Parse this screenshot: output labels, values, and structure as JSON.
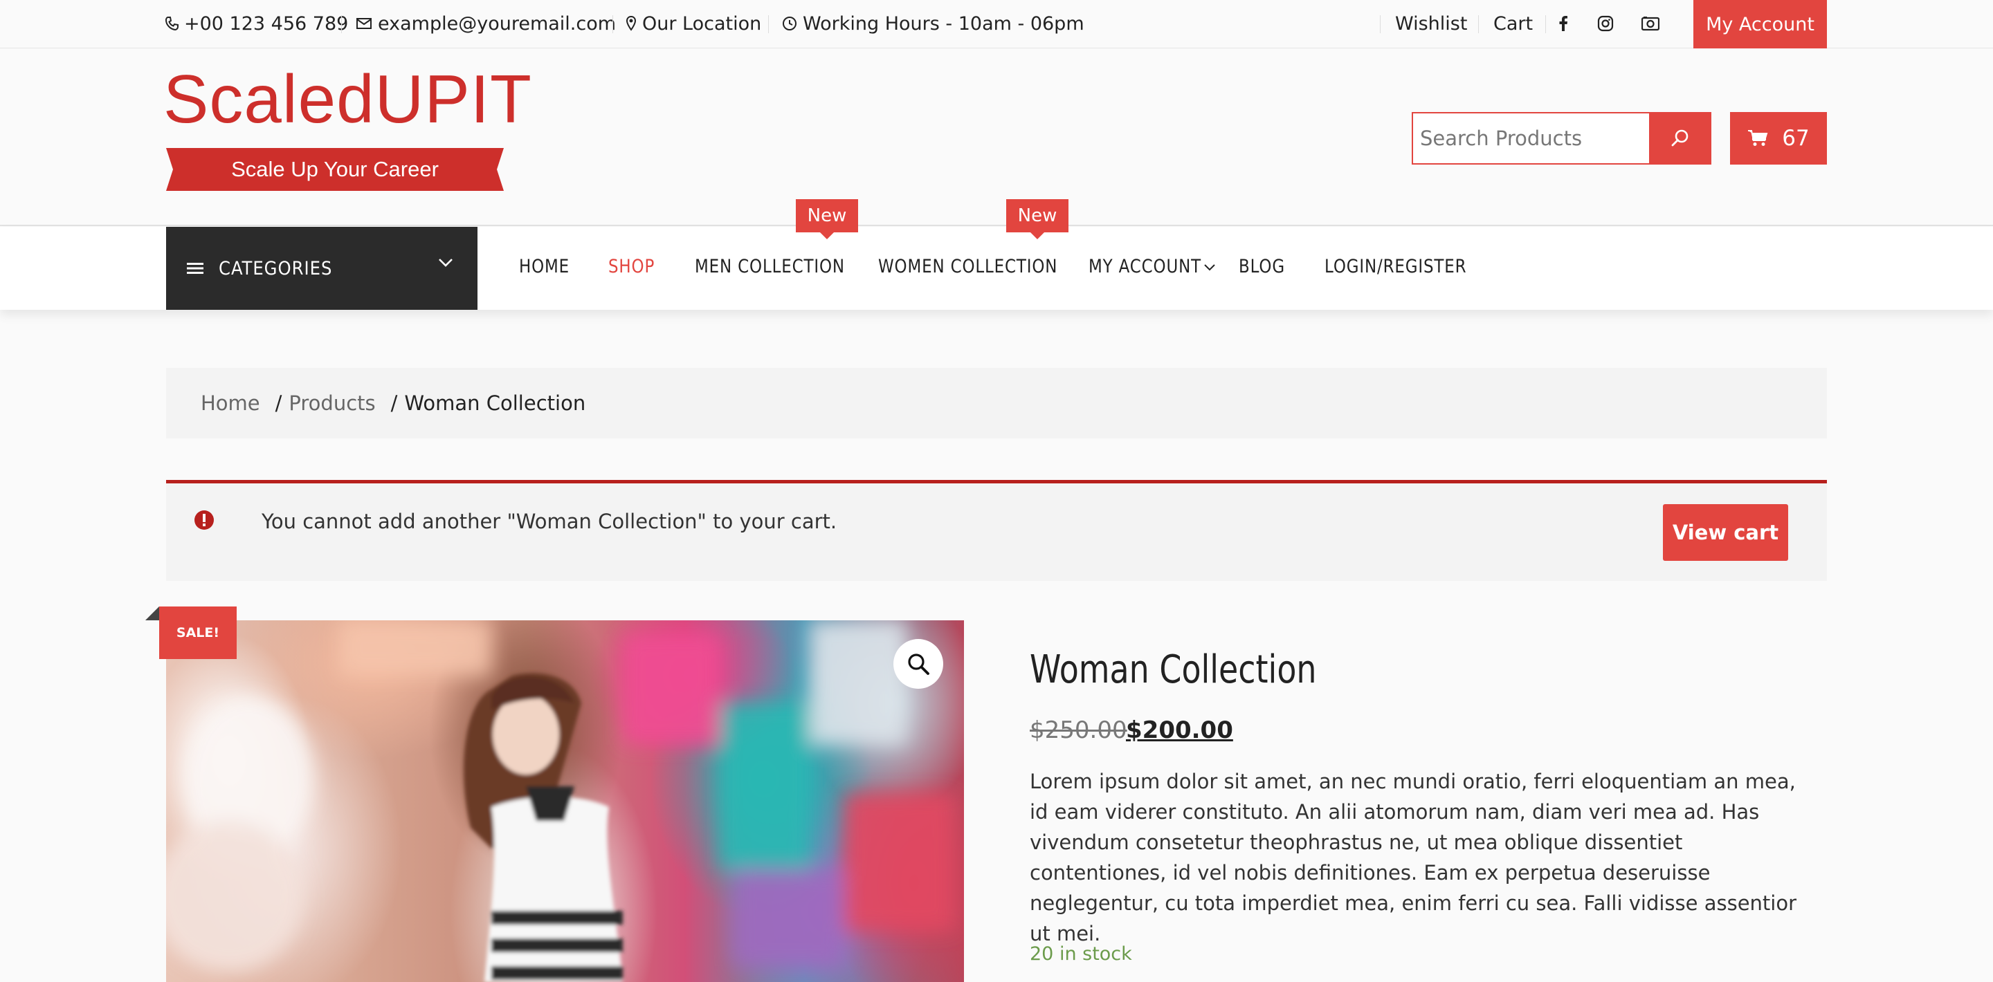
{
  "topbar": {
    "phone": "+00 123 456 789",
    "email": "example@youremail.com",
    "location": "Our Location",
    "hours": "Working Hours - 10am - 06pm",
    "wishlist": "Wishlist",
    "cart": "Cart",
    "my_account": "My Account",
    "social_icons": [
      "facebook-icon",
      "instagram-icon",
      "camera-icon"
    ]
  },
  "header": {
    "logo_text": "ScaledUPIT",
    "logo_tagline": "Scale Up Your Career",
    "search_placeholder": "Search Products",
    "cart_count": "67"
  },
  "nav": {
    "categories_label": "CATEGORIES",
    "items": [
      {
        "label": "HOME"
      },
      {
        "label": "SHOP",
        "active": true
      },
      {
        "label": "MEN COLLECTION",
        "badge": "New"
      },
      {
        "label": "WOMEN COLLECTION",
        "badge": "New"
      },
      {
        "label": "MY ACCOUNT"
      },
      {
        "label": "BLOG"
      },
      {
        "label": "LOGIN/REGISTER"
      }
    ]
  },
  "breadcrumb": {
    "items": [
      "Home",
      "Products",
      "Woman Collection"
    ]
  },
  "notice": {
    "message": "You cannot add another \"Woman Collection\" to your cart.",
    "button": "View cart"
  },
  "product": {
    "sale_badge": "SALE!",
    "title": "Woman Collection",
    "price_old": "$250.00",
    "price_new": "$200.00",
    "description": "Lorem ipsum dolor sit amet, an nec mundi oratio, ferri eloquentiam an mea, id eam viderer constituto. An alii atomorum nam, diam veri mea ad. Has vivendum consetetur theophrastus ne, ut mea oblique dissentiet contentiones, id vel nobis definitiones. Eam ex perpetua deseruisse neglegentur, cu tota imperdiet mea, enim ferri cu sea. Falli vidisse assentior ut mei.",
    "stock": "20 in stock"
  },
  "colors": {
    "accent": "#e2453f",
    "dark": "#2b2b2b",
    "logo": "#cd2f2b",
    "stock": "#6b9b4b"
  }
}
